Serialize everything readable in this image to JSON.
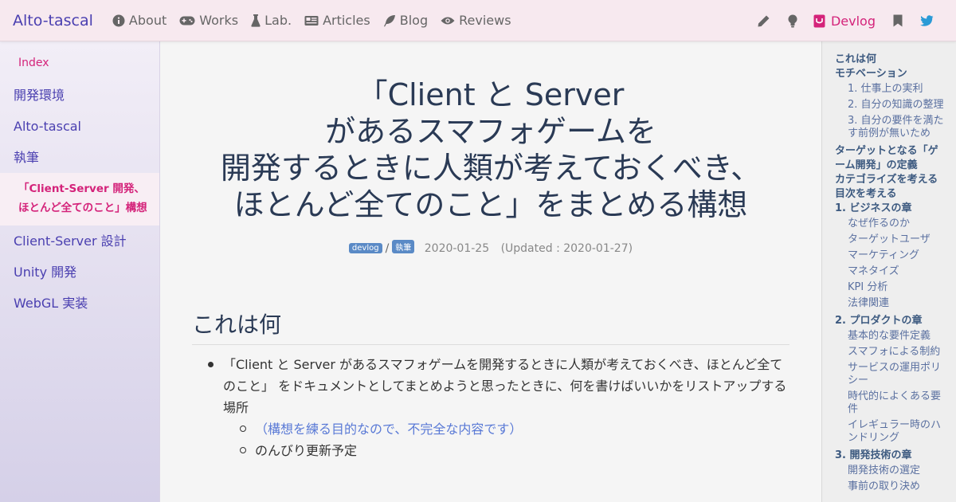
{
  "nav": {
    "brand": "Alto-tascal",
    "items": [
      {
        "label": "About",
        "icon": "info-icon"
      },
      {
        "label": "Works",
        "icon": "gamepad-icon"
      },
      {
        "label": "Lab.",
        "icon": "flask-icon"
      },
      {
        "label": "Articles",
        "icon": "newspaper-icon"
      },
      {
        "label": "Blog",
        "icon": "feather-icon"
      },
      {
        "label": "Reviews",
        "icon": "eye-icon"
      }
    ],
    "devlog": "Devlog",
    "accent": "#d4237a",
    "brand_color": "#4a3fb0"
  },
  "sidebar": {
    "index": "Index",
    "items": [
      "開発環境",
      "Alto-tascal",
      "執筆"
    ],
    "active": "「Client-Server 開発、ほとんど全てのこと」構想",
    "items_after": [
      "Client-Server 設計",
      "Unity 開発",
      "WebGL 実装"
    ]
  },
  "article": {
    "title_lines": [
      "「Client と Server",
      "があるスマフォゲームを",
      "開発するときに人類が考えておくべき、",
      "ほとんど全てのこと」をまとめる構想"
    ],
    "tags": [
      "devlog",
      "執筆"
    ],
    "date": "2020-01-25",
    "updated": "(Updated : 2020-01-27)",
    "section_title": "これは何",
    "bullet": "「Client と Server があるスマフォゲームを開発するときに人類が考えておくべき、ほとんど全てのこと」 をドキュメントとしてまとめようと思ったときに、何を書けばいいかをリストアップする場所",
    "sub_items": [
      "（構想を練る目的なので、不完全な内容です）",
      "のんびり更新予定"
    ]
  },
  "toc": {
    "h1": "これは何",
    "h2": "モチベーション",
    "motivation": [
      "1. 仕事上の実利",
      "2. 自分の知識の整理",
      "3. 自分の要件を満たす前例が無いため"
    ],
    "h3": "ターゲットとなる「ゲーム開発」の定義",
    "h4": "カテゴライズを考える",
    "h5": "目次を考える",
    "ch1": "1. ビジネスの章",
    "ch1_items": [
      "なぜ作るのか",
      "ターゲットユーザ",
      "マーケティング",
      "マネタイズ",
      "KPI 分析",
      "法律関連"
    ],
    "ch2": "2. プロダクトの章",
    "ch2_items": [
      "基本的な要件定義",
      "スマフォによる制約",
      "サービスの運用ポリシー",
      "時代的によくある要件",
      "イレギュラー時のハンドリング"
    ],
    "ch3": "3. 開発技術の章",
    "ch3_items": [
      "開発技術の選定",
      "事前の取り決め"
    ]
  }
}
